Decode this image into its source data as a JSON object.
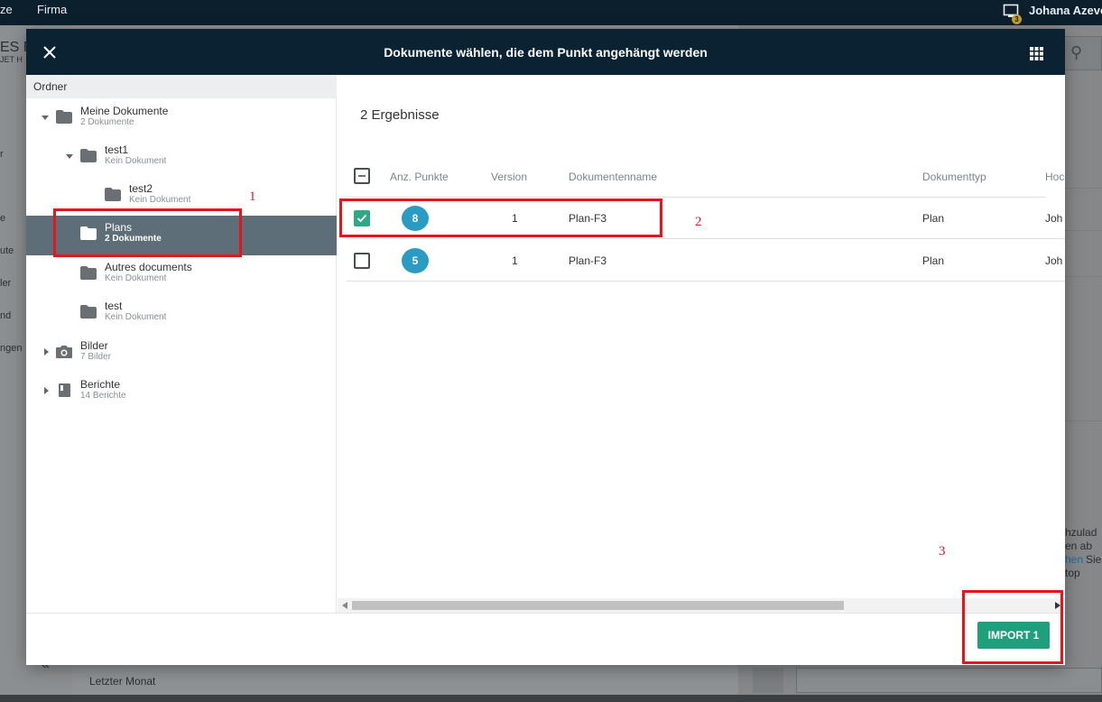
{
  "background": {
    "nav_left_fragment": "ze",
    "nav_firma": "Firma",
    "user_name": "Johana Azevedo",
    "bell_badge": "3",
    "title_fragment": "ES P",
    "subtitle_fragment": "JET H",
    "side_fragments": [
      "r",
      "e",
      "ute",
      "ler",
      "nd",
      "ngen"
    ],
    "right_fragments": [
      "hzulad",
      "en ab",
      "hen",
      "Sie",
      "top"
    ],
    "bottom_text": "Letzter Monat",
    "collapse_glyph": "«",
    "search_icon_glyph": "⚲"
  },
  "modal": {
    "title": "Dokumente wählen, die dem Punkt angehängt werden",
    "close_glyph": "✕"
  },
  "tree": {
    "header": "Ordner",
    "items": [
      {
        "name": "Meine Dokumente",
        "sub": "2 Dokumente",
        "icon": "folder-icon",
        "expanded": true
      },
      {
        "name": "test1",
        "sub": "Kein Dokument",
        "icon": "folder-icon",
        "expanded": true
      },
      {
        "name": "test2",
        "sub": "Kein Dokument",
        "icon": "folder-icon"
      },
      {
        "name": "Plans",
        "sub": "2 Dokumente",
        "icon": "folder-icon",
        "selected": true
      },
      {
        "name": "Autres documents",
        "sub": "Kein Dokument",
        "icon": "folder-icon"
      },
      {
        "name": "test",
        "sub": "Kein Dokument",
        "icon": "folder-icon"
      },
      {
        "name": "Bilder",
        "sub": "7 Bilder",
        "icon": "camera-icon",
        "expanded": false
      },
      {
        "name": "Berichte",
        "sub": "14 Berichte",
        "icon": "report-icon",
        "expanded": false
      }
    ]
  },
  "results": {
    "count_label": "2 Ergebnisse",
    "columns": [
      "Anz. Punkte",
      "Version",
      "Dokumentenname",
      "Dokumenttyp",
      "Hoc"
    ],
    "rows": [
      {
        "checked": true,
        "points": "8",
        "version": "1",
        "name": "Plan-F3",
        "type": "Plan",
        "owner": "Joh"
      },
      {
        "checked": false,
        "points": "5",
        "version": "1",
        "name": "Plan-F3",
        "type": "Plan",
        "owner": "Joh"
      }
    ]
  },
  "footer": {
    "import_label": "IMPORT 1"
  },
  "annotations": [
    "1",
    "2",
    "3"
  ],
  "colors": {
    "header_bg": "#0b2233",
    "selected_row": "#5e6e78",
    "checkbox_green": "#2ea886",
    "badge_blue": "#2a9cc3",
    "import_green": "#1fa07c",
    "annotation_red": "#e8141b"
  }
}
